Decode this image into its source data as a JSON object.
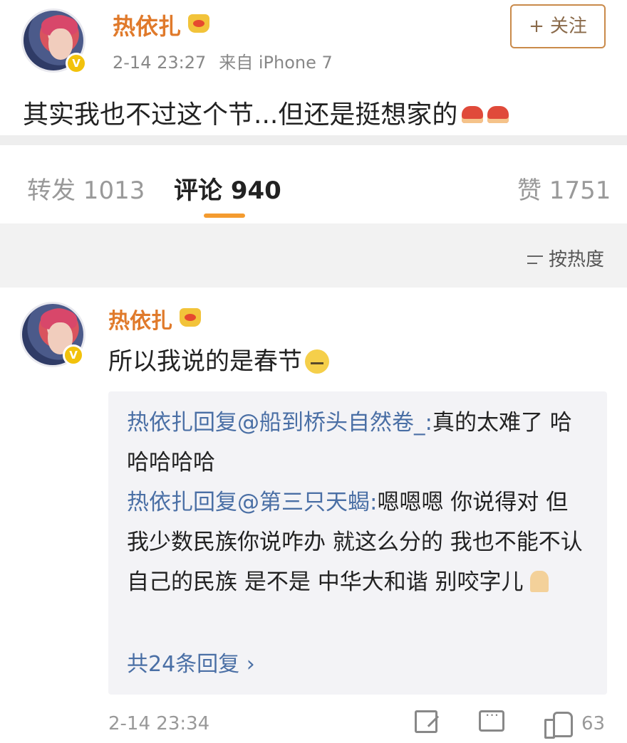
{
  "post": {
    "username": "热依扎",
    "time": "2-14 23:27",
    "source": "来自 iPhone 7",
    "follow_label": "关注",
    "follow_icon": "+",
    "text": "其实我也不过这个节...但还是挺想家的",
    "verified_mark": "V"
  },
  "tabs": {
    "repost": "转发 1013",
    "comments": "评论 940",
    "likes": "赞 1751"
  },
  "sort": {
    "label": "按热度"
  },
  "comment": {
    "username": "热依扎",
    "text": "所以我说的是春节",
    "verified_mark": "V",
    "replies": [
      {
        "author": "热依扎回复@船到桥头自然卷_:",
        "text": "真的太难了 哈哈哈哈哈"
      },
      {
        "author": "热依扎回复@第三只天蝎:",
        "text": "嗯嗯嗯 你说得对 但我少数民族你说咋办 就这么分的 我也不能不认自己的民族 是不是 中华大和谐 别咬字儿 "
      }
    ],
    "more_replies": "共24条回复 ›",
    "time": "2-14 23:34",
    "like_count": "63"
  },
  "colors": {
    "username": "#e07a2b",
    "link": "#4a6fa5",
    "tab_underline": "#f49b2f",
    "verified": "#f2c20c"
  }
}
